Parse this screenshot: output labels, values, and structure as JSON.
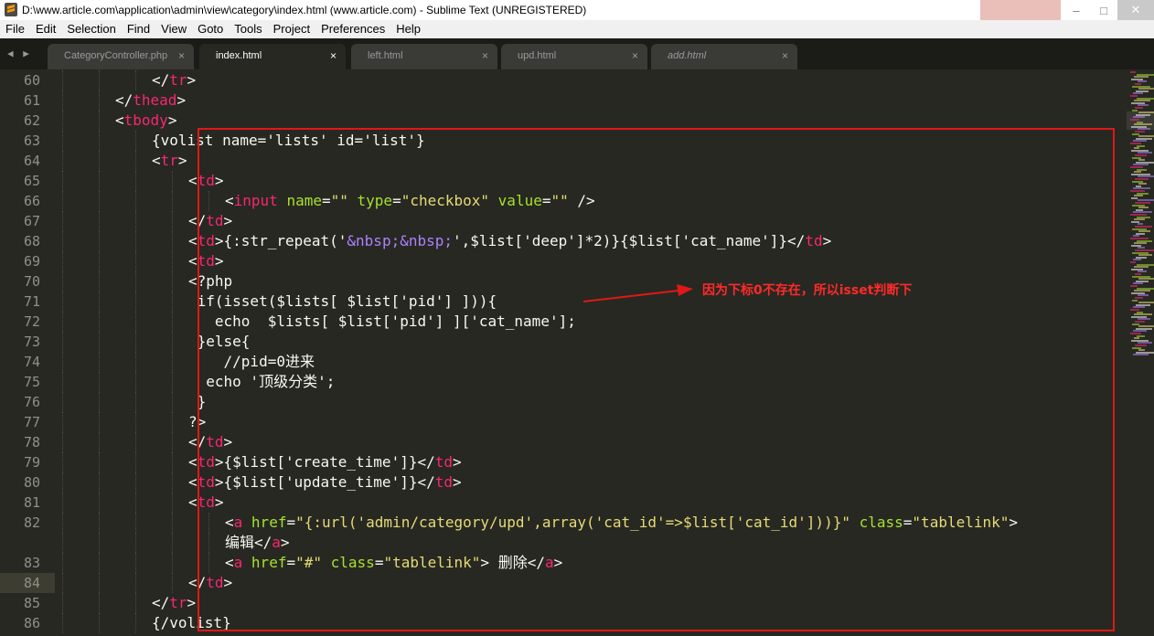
{
  "window": {
    "title": "D:\\www.article.com\\application\\admin\\view\\category\\index.html (www.article.com) - Sublime Text (UNREGISTERED)",
    "controls": {
      "minimize": "–",
      "maximize": "□",
      "close": "✕"
    }
  },
  "menu": [
    "File",
    "Edit",
    "Selection",
    "Find",
    "View",
    "Goto",
    "Tools",
    "Project",
    "Preferences",
    "Help"
  ],
  "tabs": [
    {
      "label": "CategoryController.php",
      "active": false,
      "italic": false
    },
    {
      "label": "index.html",
      "active": true,
      "italic": false
    },
    {
      "label": "left.html",
      "active": false,
      "italic": false
    },
    {
      "label": "upd.html",
      "active": false,
      "italic": false
    },
    {
      "label": "add.html",
      "active": false,
      "italic": true
    }
  ],
  "tab_close_glyph": "×",
  "nav_arrows": "◀ ▶",
  "editor": {
    "current_line": "84",
    "lines": [
      {
        "n": "60",
        "indent": 4,
        "tokens": [
          [
            "p",
            "</"
          ],
          [
            "tag",
            "tr"
          ],
          [
            "p",
            ">"
          ]
        ]
      },
      {
        "n": "61",
        "indent": 3,
        "tokens": [
          [
            "p",
            "</"
          ],
          [
            "tag",
            "thead"
          ],
          [
            "p",
            ">"
          ]
        ]
      },
      {
        "n": "62",
        "indent": 3,
        "tokens": [
          [
            "p",
            "<"
          ],
          [
            "tag",
            "tbody"
          ],
          [
            "p",
            ">"
          ]
        ]
      },
      {
        "n": "63",
        "indent": 4,
        "tokens": [
          [
            "p",
            "{volist name='lists' id='list'}"
          ]
        ]
      },
      {
        "n": "64",
        "indent": 4,
        "tokens": [
          [
            "p",
            "<"
          ],
          [
            "tag",
            "tr"
          ],
          [
            "p",
            ">"
          ]
        ]
      },
      {
        "n": "65",
        "indent": 5,
        "tokens": [
          [
            "p",
            "<"
          ],
          [
            "tag",
            "td"
          ],
          [
            "p",
            ">"
          ]
        ]
      },
      {
        "n": "66",
        "indent": 6,
        "tokens": [
          [
            "p",
            "<"
          ],
          [
            "tag",
            "input"
          ],
          [
            "p",
            " "
          ],
          [
            "attr",
            "name"
          ],
          [
            "p",
            "="
          ],
          [
            "str",
            "\"\""
          ],
          [
            "p",
            " "
          ],
          [
            "attr",
            "type"
          ],
          [
            "p",
            "="
          ],
          [
            "str",
            "\"checkbox\""
          ],
          [
            "p",
            " "
          ],
          [
            "attr",
            "value"
          ],
          [
            "p",
            "="
          ],
          [
            "str",
            "\"\""
          ],
          [
            "p",
            " />"
          ]
        ]
      },
      {
        "n": "67",
        "indent": 5,
        "tokens": [
          [
            "p",
            "</"
          ],
          [
            "tag",
            "td"
          ],
          [
            "p",
            ">"
          ]
        ]
      },
      {
        "n": "68",
        "indent": 5,
        "tokens": [
          [
            "p",
            "<"
          ],
          [
            "tag",
            "td"
          ],
          [
            "p",
            ">{:str_repeat('"
          ],
          [
            "ent",
            "&nbsp;&nbsp;"
          ],
          [
            "p",
            "',$list['deep']*2)}{$list['cat_name']}</"
          ],
          [
            "tag",
            "td"
          ],
          [
            "p",
            ">"
          ]
        ]
      },
      {
        "n": "69",
        "indent": 5,
        "tokens": [
          [
            "p",
            "<"
          ],
          [
            "tag",
            "td"
          ],
          [
            "p",
            ">"
          ]
        ]
      },
      {
        "n": "70",
        "indent": 5,
        "tokens": [
          [
            "p",
            "<?php"
          ]
        ]
      },
      {
        "n": "71",
        "indent": 5,
        "tokens": [
          [
            "p",
            " if(isset($lists[ $list['pid'] ])){"
          ]
        ]
      },
      {
        "n": "72",
        "indent": 5,
        "tokens": [
          [
            "p",
            "   echo  $lists[ $list['pid'] ]['cat_name'];"
          ]
        ]
      },
      {
        "n": "73",
        "indent": 5,
        "tokens": [
          [
            "p",
            " }else{"
          ]
        ]
      },
      {
        "n": "74",
        "indent": 5,
        "tokens": [
          [
            "p",
            "    //pid=0进来"
          ]
        ]
      },
      {
        "n": "75",
        "indent": 5,
        "tokens": [
          [
            "p",
            "  echo '顶级分类';"
          ]
        ]
      },
      {
        "n": "76",
        "indent": 5,
        "tokens": [
          [
            "p",
            " }"
          ]
        ]
      },
      {
        "n": "77",
        "indent": 5,
        "tokens": [
          [
            "p",
            "?>"
          ]
        ]
      },
      {
        "n": "78",
        "indent": 5,
        "tokens": [
          [
            "p",
            "</"
          ],
          [
            "tag",
            "td"
          ],
          [
            "p",
            ">"
          ]
        ]
      },
      {
        "n": "79",
        "indent": 5,
        "tokens": [
          [
            "p",
            "<"
          ],
          [
            "tag",
            "td"
          ],
          [
            "p",
            ">{$list['create_time']}</"
          ],
          [
            "tag",
            "td"
          ],
          [
            "p",
            ">"
          ]
        ]
      },
      {
        "n": "80",
        "indent": 5,
        "tokens": [
          [
            "p",
            "<"
          ],
          [
            "tag",
            "td"
          ],
          [
            "p",
            ">{$list['update_time']}</"
          ],
          [
            "tag",
            "td"
          ],
          [
            "p",
            ">"
          ]
        ]
      },
      {
        "n": "81",
        "indent": 5,
        "tokens": [
          [
            "p",
            "<"
          ],
          [
            "tag",
            "td"
          ],
          [
            "p",
            ">"
          ]
        ]
      },
      {
        "n": "82",
        "indent": 6,
        "tokens": [
          [
            "p",
            "<"
          ],
          [
            "tag",
            "a"
          ],
          [
            "p",
            " "
          ],
          [
            "attr",
            "href"
          ],
          [
            "p",
            "="
          ],
          [
            "str",
            "\"{:url('admin/category/upd',array('cat_id'=>$list['cat_id']))}\""
          ],
          [
            "p",
            " "
          ],
          [
            "attr",
            "class"
          ],
          [
            "p",
            "="
          ],
          [
            "str",
            "\"tablelink\""
          ],
          [
            "p",
            ">"
          ]
        ]
      },
      {
        "n": "",
        "indent": 6,
        "tokens": [
          [
            "p",
            "编辑</"
          ],
          [
            "tag",
            "a"
          ],
          [
            "p",
            ">"
          ]
        ]
      },
      {
        "n": "83",
        "indent": 6,
        "tokens": [
          [
            "p",
            "<"
          ],
          [
            "tag",
            "a"
          ],
          [
            "p",
            " "
          ],
          [
            "attr",
            "href"
          ],
          [
            "p",
            "="
          ],
          [
            "str",
            "\"#\""
          ],
          [
            "p",
            " "
          ],
          [
            "attr",
            "class"
          ],
          [
            "p",
            "="
          ],
          [
            "str",
            "\"tablelink\""
          ],
          [
            "p",
            "> 删除</"
          ],
          [
            "tag",
            "a"
          ],
          [
            "p",
            ">"
          ]
        ]
      },
      {
        "n": "84",
        "indent": 5,
        "tokens": [
          [
            "p",
            "</"
          ],
          [
            "tag",
            "td"
          ],
          [
            "p",
            ">"
          ]
        ]
      },
      {
        "n": "85",
        "indent": 4,
        "tokens": [
          [
            "p",
            "</"
          ],
          [
            "tag",
            "tr"
          ],
          [
            "p",
            ">"
          ]
        ]
      },
      {
        "n": "86",
        "indent": 4,
        "tokens": [
          [
            "p",
            "{/volist}"
          ]
        ]
      }
    ]
  },
  "annotation": {
    "text": "因为下标0不存在，所以isset判断下",
    "color": "#ff2a2a"
  },
  "colors": {
    "background": "#272822",
    "tag": "#f92672",
    "attr": "#a6e22e",
    "string": "#e6db74",
    "entity": "#ae81ff",
    "plain": "#f8f8f2",
    "highlight_box": "#e01818"
  }
}
